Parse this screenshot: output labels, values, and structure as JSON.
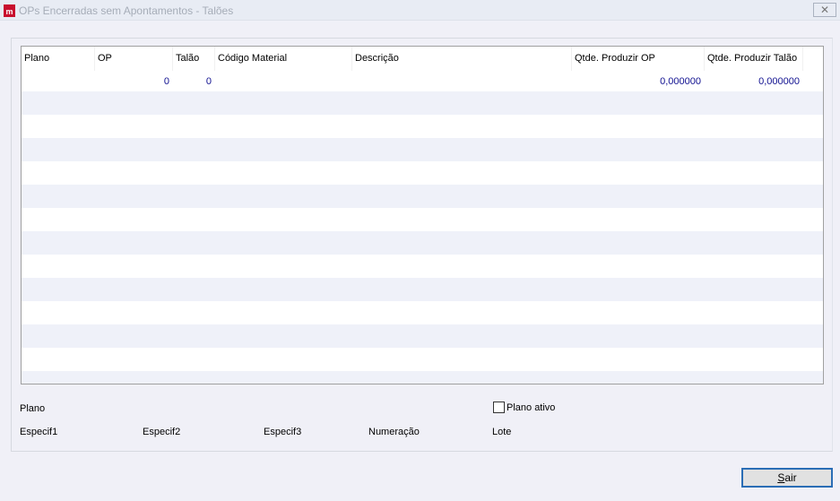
{
  "window": {
    "title": "OPs Encerradas sem Apontamentos - Talões",
    "close_label": "✕"
  },
  "grid": {
    "columns": [
      "Plano",
      "OP",
      "Talão",
      "Código Material",
      "Descrição",
      "Qtde. Produzir OP",
      "Qtde. Produzir Talão"
    ],
    "rows": [
      [
        "",
        "0",
        "0",
        "",
        "",
        "0,000000",
        "0,000000"
      ]
    ]
  },
  "footer": {
    "plano": "Plano",
    "plano_ativo": "Plano ativo",
    "especif1": "Especif1",
    "especif2": "Especif2",
    "especif3": "Especif3",
    "numeracao": "Numeração",
    "lote": "Lote"
  },
  "buttons": {
    "sair_prefix": "S",
    "sair_rest": "air"
  }
}
